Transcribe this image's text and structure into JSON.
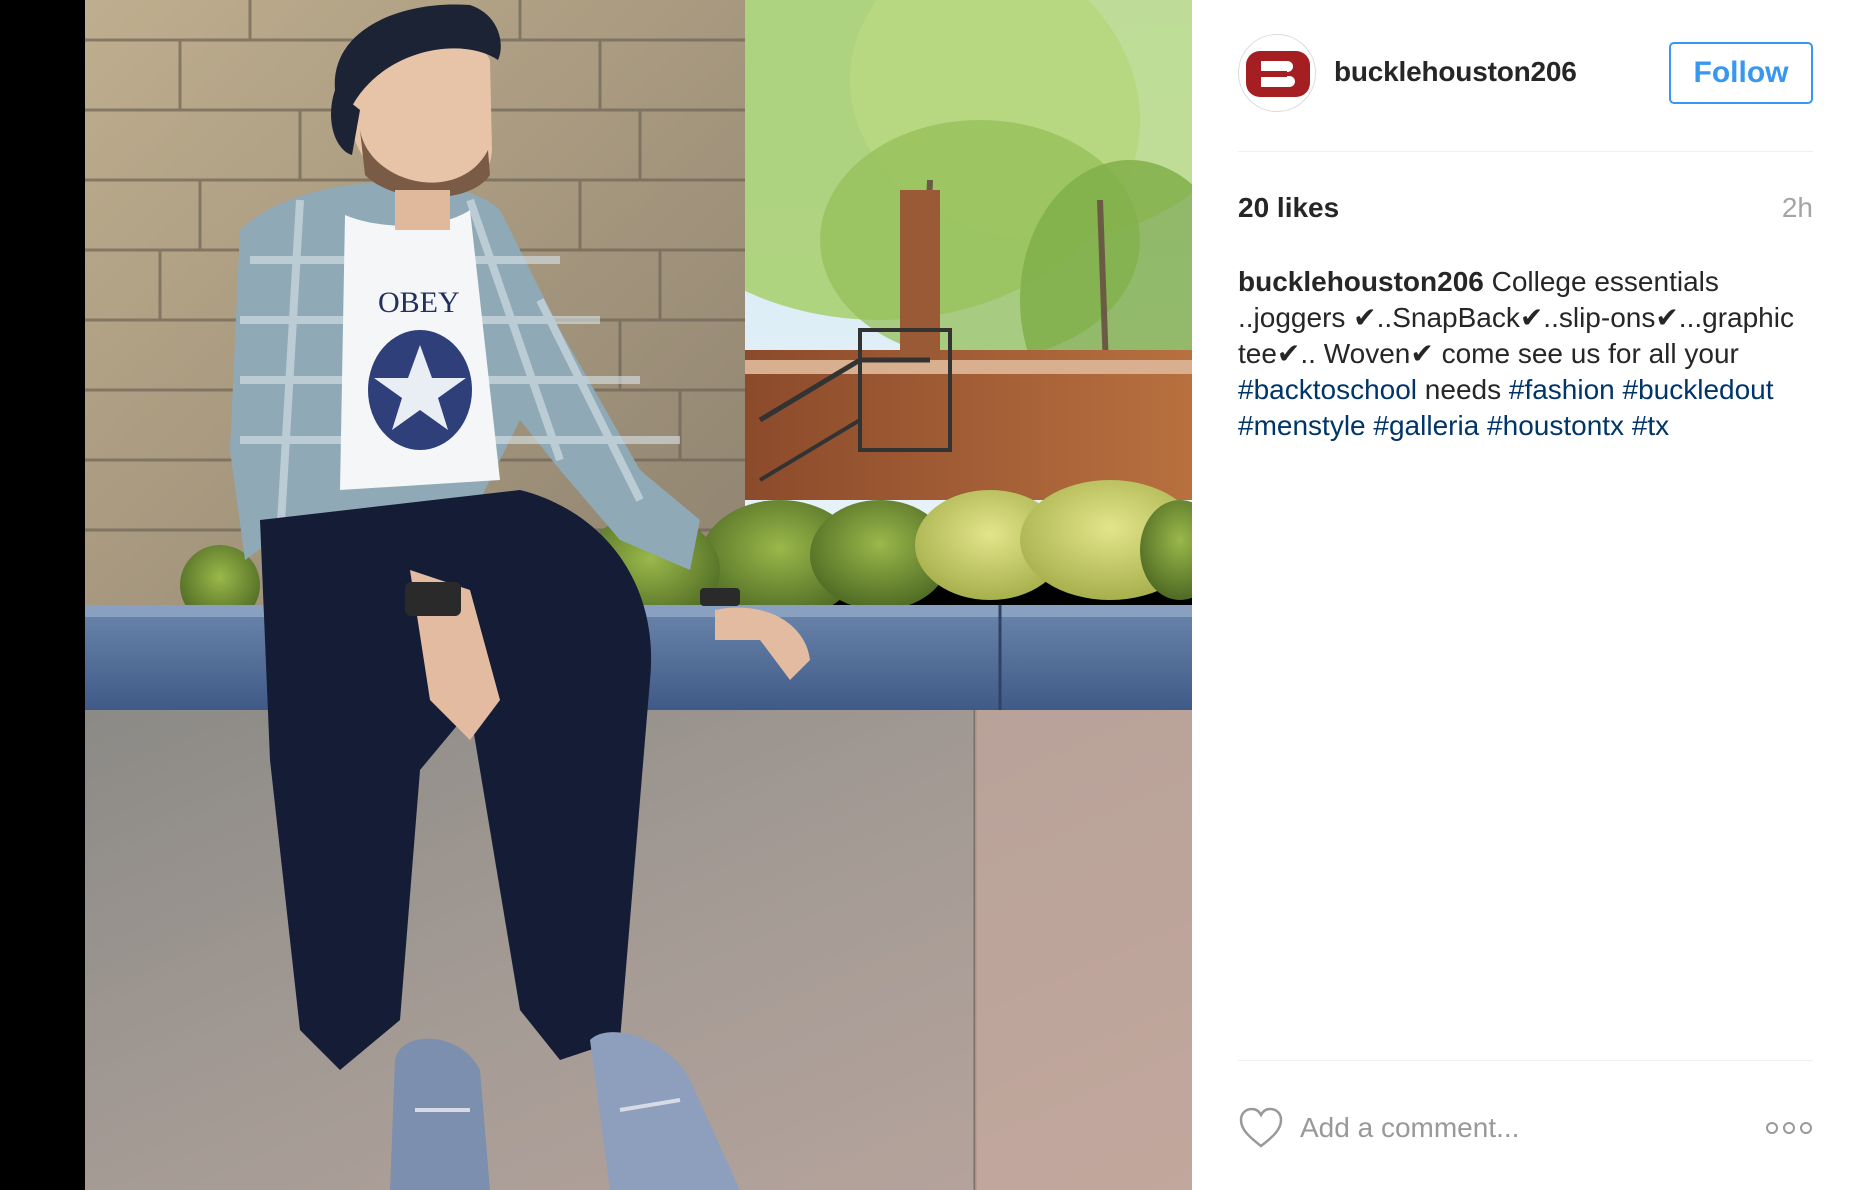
{
  "post": {
    "username": "bucklehouston206",
    "follow_label": "Follow",
    "likes": "20 likes",
    "time_ago": "2h",
    "caption": {
      "user": "bucklehouston206",
      "text": "College essentials ..joggers ✔..SnapBack✔..slip-ons✔...graphic tee✔.. Woven✔ come see us for all your",
      "hashtags": [
        "#backtoschool"
      ],
      "after": "needs",
      "more_hashtags": [
        "#fashion",
        "#buckledout",
        "#menstyle",
        "#galleria",
        "#houstontx",
        "#tx"
      ]
    },
    "comment_placeholder": "Add a comment...",
    "icons": {
      "like": "heart-outline-icon",
      "more": "more-options-icon",
      "avatar_logo": "buckle-b-logo"
    },
    "colors": {
      "follow_blue": "#3897f0",
      "hashtag": "#003569",
      "brand_red": "#a51e22"
    },
    "photo": {
      "shirt_print": "OBEY"
    }
  }
}
